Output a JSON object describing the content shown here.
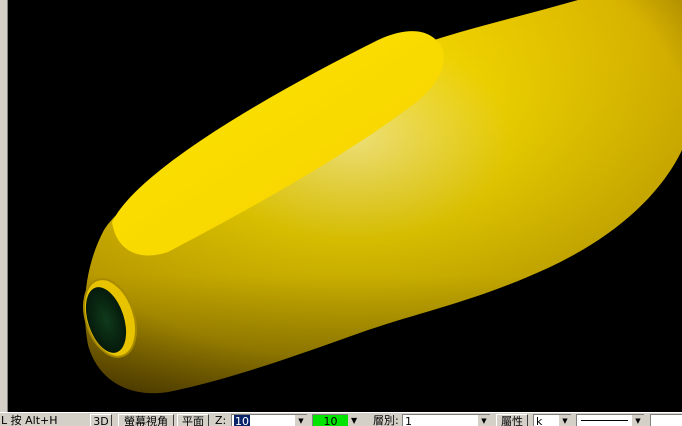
{
  "statusbar": {
    "hint": "L 按 Alt+H",
    "view_3d_label": "3D",
    "perspective_label": "螢幕視角",
    "plane_label": "平面",
    "z_label": "Z:",
    "z_value": "10",
    "green_value": "10",
    "layer_label": "層別:",
    "layer_value": "1",
    "attribute_label": "屬性",
    "attribute_value": "k"
  },
  "icons": {
    "dropdown": "chevron-down-icon",
    "arrow": "triangle-down-icon"
  },
  "colors": {
    "model_yellow": "#f5d800",
    "background": "#000000",
    "panel": "#d4d0c8",
    "indicator_green": "#00e400",
    "hole_green": "#0a2e14"
  }
}
